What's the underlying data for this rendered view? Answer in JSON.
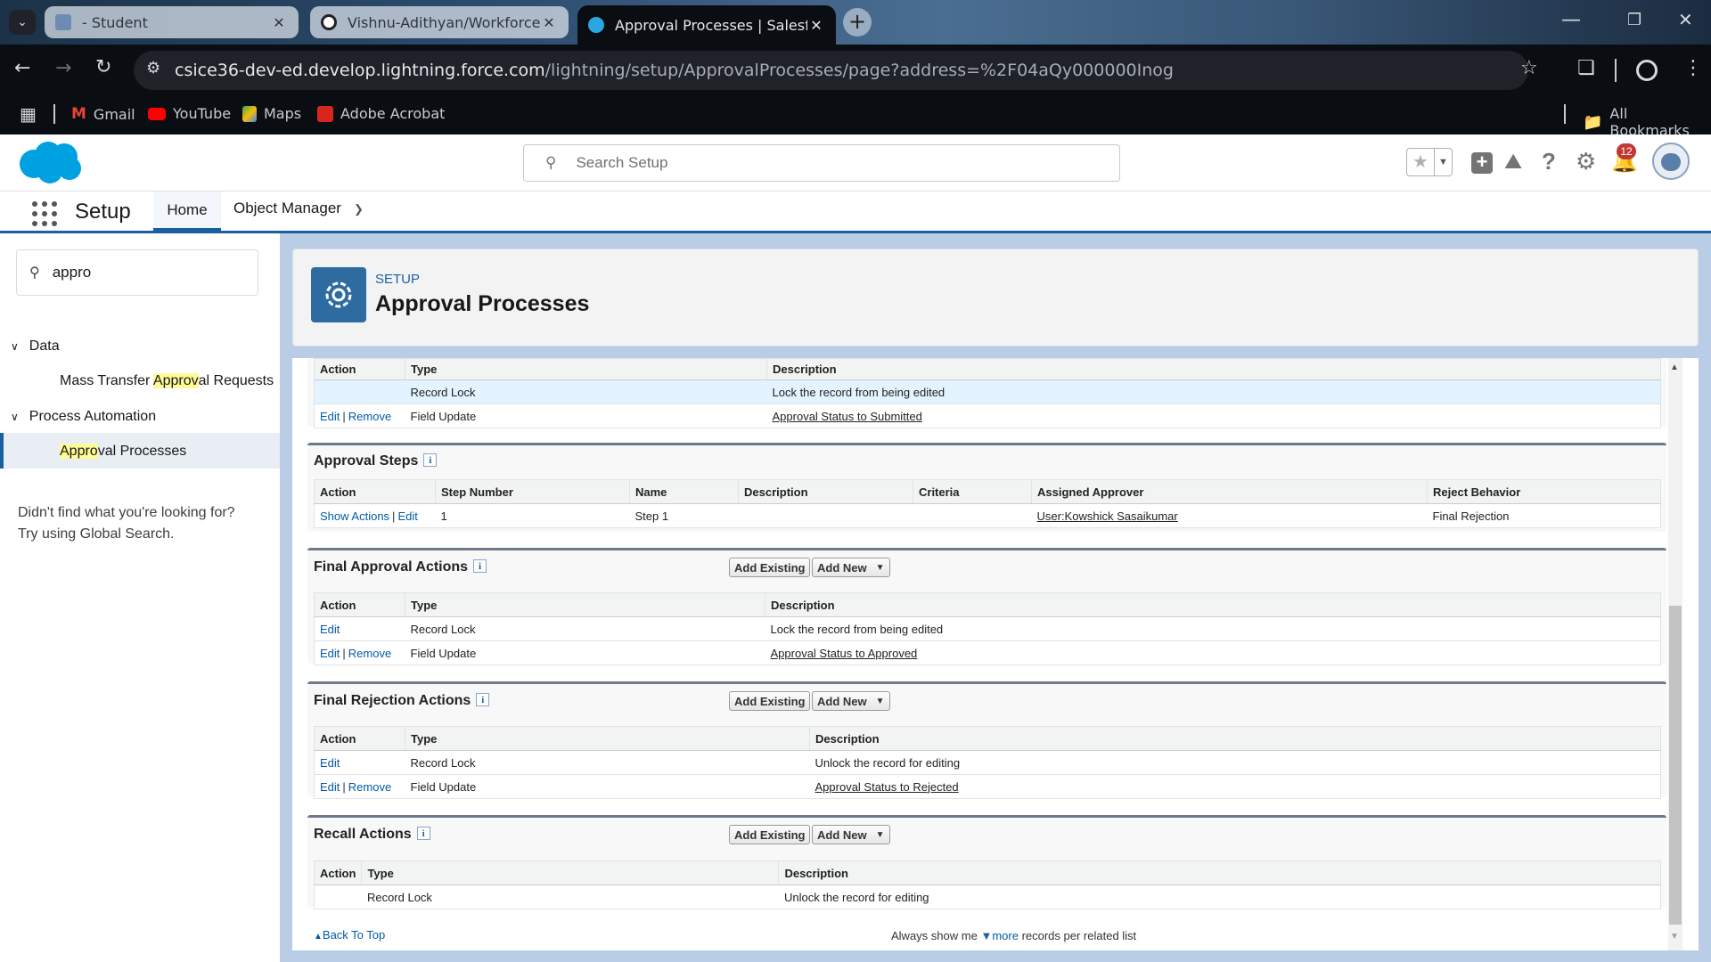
{
  "browser": {
    "tabs": [
      {
        "title": "- Student",
        "active": false
      },
      {
        "title": "Vishnu-Adithyan/Workforce-Av",
        "active": false
      },
      {
        "title": "Approval Processes | Salesforce",
        "active": true
      }
    ],
    "url_host": "csice36-dev-ed.develop.lightning.force.com",
    "url_path": "/lightning/setup/ApprovalProcesses/page?address=%2F04aQy000000Inog",
    "bookmarks": [
      "Gmail",
      "YouTube",
      "Maps",
      "Adobe Acrobat"
    ],
    "all_bookmarks": "All Bookmarks"
  },
  "header": {
    "search_placeholder": "Search Setup",
    "notification_count": "12"
  },
  "nav": {
    "app_name": "Setup",
    "tabs": [
      "Home",
      "Object Manager"
    ]
  },
  "sidebar": {
    "quick_find_value": "appro",
    "groups": [
      {
        "label": "Data",
        "item_pre": "Mass Transfer ",
        "item_hl": "Approv",
        "item_post": "al Requests"
      },
      {
        "label": "Process Automation",
        "item_pre": "",
        "item_hl": "Appro",
        "item_post": "val Processes"
      }
    ],
    "not_found_line1": "Didn't find what you're looking for?",
    "not_found_line2": "Try using Global Search."
  },
  "page": {
    "breadcrumb": "SETUP",
    "title": "Approval Processes"
  },
  "labels": {
    "edit": "Edit",
    "remove": "Remove",
    "show_actions": "Show Actions",
    "add_existing": "Add Existing",
    "add_new": "Add New",
    "sep": "|"
  },
  "initial_submission": {
    "headers": [
      "Action",
      "Type",
      "Description"
    ],
    "rows": [
      {
        "type": "Record Lock",
        "description": "Lock the record from being edited"
      },
      {
        "type": "Field Update",
        "description": "Approval Status to Submitted"
      }
    ]
  },
  "approval_steps": {
    "title": "Approval Steps",
    "headers": [
      "Action",
      "Step Number",
      "Name",
      "Description",
      "Criteria",
      "Assigned Approver",
      "Reject Behavior"
    ],
    "row": {
      "step_number": "1",
      "name": "Step 1",
      "description": "",
      "criteria": "",
      "approver": "User:Kowshick Sasaikumar",
      "reject_behavior": "Final Rejection"
    }
  },
  "final_approval": {
    "title": "Final Approval Actions",
    "headers": [
      "Action",
      "Type",
      "Description"
    ],
    "rows": [
      {
        "type": "Record Lock",
        "description": "Lock the record from being edited"
      },
      {
        "type": "Field Update",
        "description": "Approval Status to Approved"
      }
    ]
  },
  "final_rejection": {
    "title": "Final Rejection Actions",
    "headers": [
      "Action",
      "Type",
      "Description"
    ],
    "rows": [
      {
        "type": "Record Lock",
        "description": "Unlock the record for editing"
      },
      {
        "type": "Field Update",
        "description": "Approval Status to Rejected"
      }
    ]
  },
  "recall": {
    "title": "Recall Actions",
    "headers": [
      "Action",
      "Type",
      "Description"
    ],
    "rows": [
      {
        "type": "Record Lock",
        "description": "Unlock the record for editing"
      }
    ]
  },
  "footer": {
    "back_to_top": "Back To Top",
    "always_show": "Always show me",
    "more": "more",
    "per_list": "records per related list"
  }
}
